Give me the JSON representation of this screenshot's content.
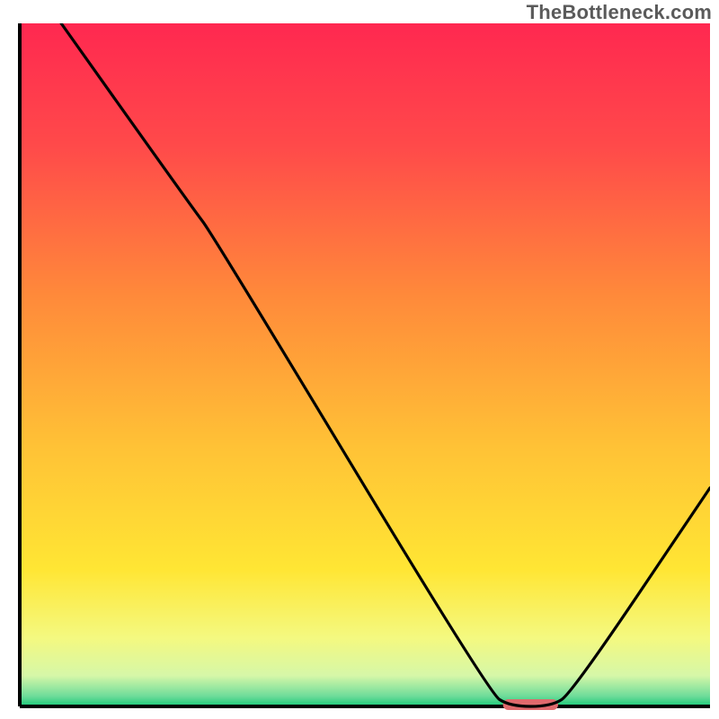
{
  "watermark": "TheBottleneck.com",
  "chart_data": {
    "type": "line",
    "title": "",
    "xlabel": "",
    "ylabel": "",
    "xlim": [
      0,
      100
    ],
    "ylim": [
      0,
      100
    ],
    "optimal_marker": {
      "x_start": 70,
      "x_end": 78,
      "y": 0,
      "color": "#e06a6d"
    },
    "series": [
      {
        "name": "bottleneck-curve",
        "color": "#000000",
        "points": [
          {
            "x": 6,
            "y": 100
          },
          {
            "x": 25,
            "y": 73
          },
          {
            "x": 28,
            "y": 69
          },
          {
            "x": 68,
            "y": 2
          },
          {
            "x": 71,
            "y": 0
          },
          {
            "x": 77,
            "y": 0
          },
          {
            "x": 80,
            "y": 2
          },
          {
            "x": 100,
            "y": 32
          }
        ]
      }
    ],
    "background_gradient": {
      "stops": [
        {
          "offset": 0.0,
          "color": "#ff2850"
        },
        {
          "offset": 0.18,
          "color": "#ff4a4a"
        },
        {
          "offset": 0.4,
          "color": "#ff8a3a"
        },
        {
          "offset": 0.62,
          "color": "#ffc236"
        },
        {
          "offset": 0.8,
          "color": "#ffe634"
        },
        {
          "offset": 0.9,
          "color": "#f4f980"
        },
        {
          "offset": 0.955,
          "color": "#d6f7a8"
        },
        {
          "offset": 0.985,
          "color": "#6edc9a"
        },
        {
          "offset": 1.0,
          "color": "#17c877"
        }
      ]
    }
  }
}
